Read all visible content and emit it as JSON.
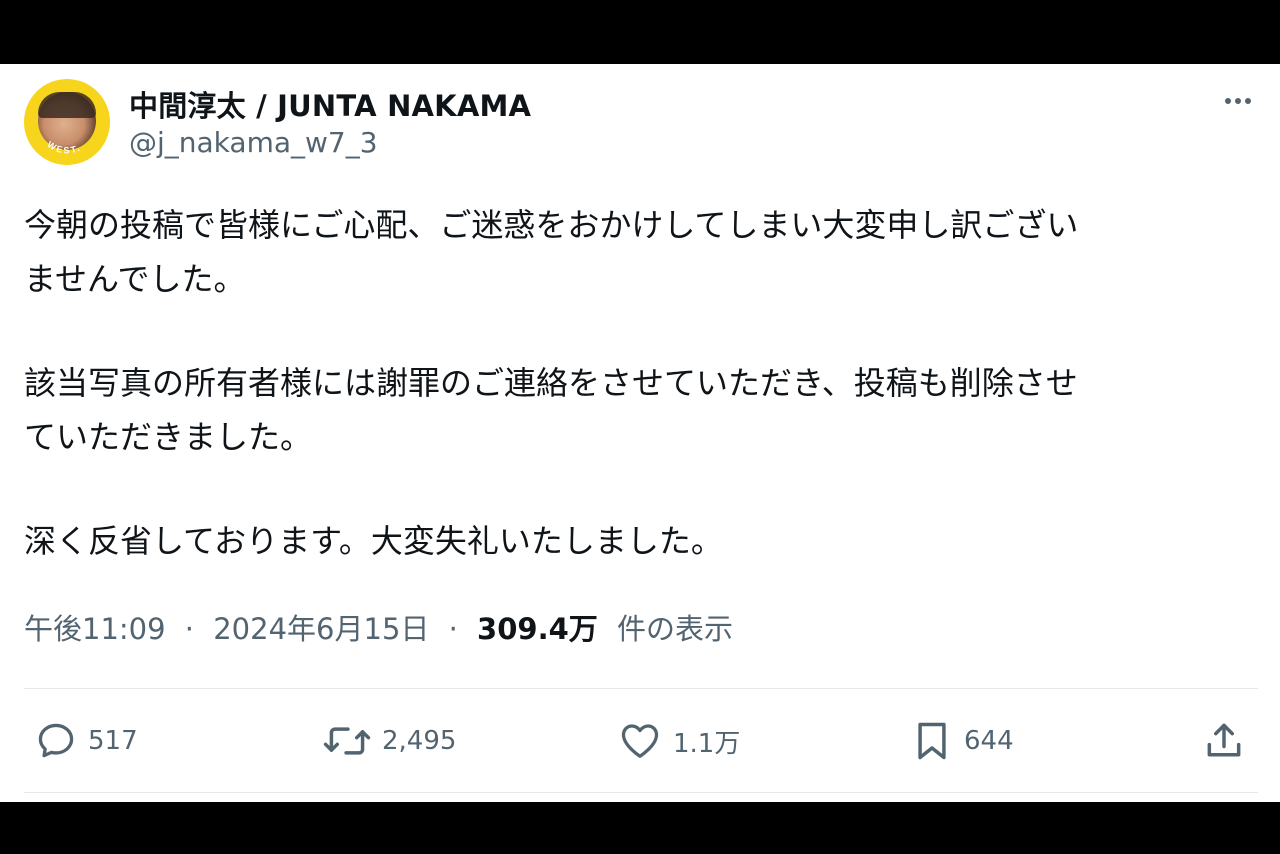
{
  "author": {
    "display_name": "中間淳太 / JUNTA NAKAMA",
    "handle": "@j_nakama_w7_3",
    "avatar_badge_text": "WEST."
  },
  "post": {
    "lines": [
      "今朝の投稿で皆様にご心配、ご迷惑をおかけしてしまい大変申し訳ござい",
      "ませんでした。",
      "該当写真の所有者様には謝罪のご連絡をさせていただき、投稿も削除させ",
      "ていただきました。",
      "深く反省しております。大変失礼いたしました。"
    ]
  },
  "meta": {
    "time": "午後11:09",
    "separator": "·",
    "date": "2024年6月15日",
    "views_count": "309.4万",
    "views_label": "件の表示"
  },
  "actions": {
    "replies": "517",
    "reposts": "2,495",
    "likes": "1.1万",
    "bookmarks": "644"
  },
  "icons": {
    "more": "more-horizontal-icon",
    "reply": "reply-icon",
    "repost": "repost-icon",
    "like": "heart-icon",
    "bookmark": "bookmark-icon",
    "share": "share-icon"
  },
  "colors": {
    "text": "#0f1419",
    "secondary": "#536471",
    "avatar_ring": "#f7d51d",
    "background": "#ffffff",
    "frame": "#000000"
  }
}
